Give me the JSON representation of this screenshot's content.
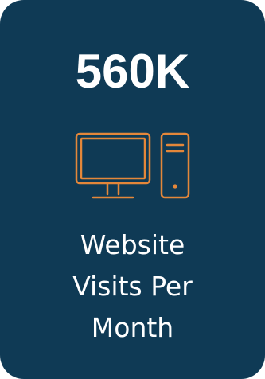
{
  "card": {
    "value": "560K",
    "label_lines": [
      "Website",
      "Visits Per",
      "Month"
    ],
    "icon": "desktop-computer-icon"
  },
  "colors": {
    "card_background": "#0f3a55",
    "text": "#ffffff",
    "icon_accent": "#e4873a"
  }
}
